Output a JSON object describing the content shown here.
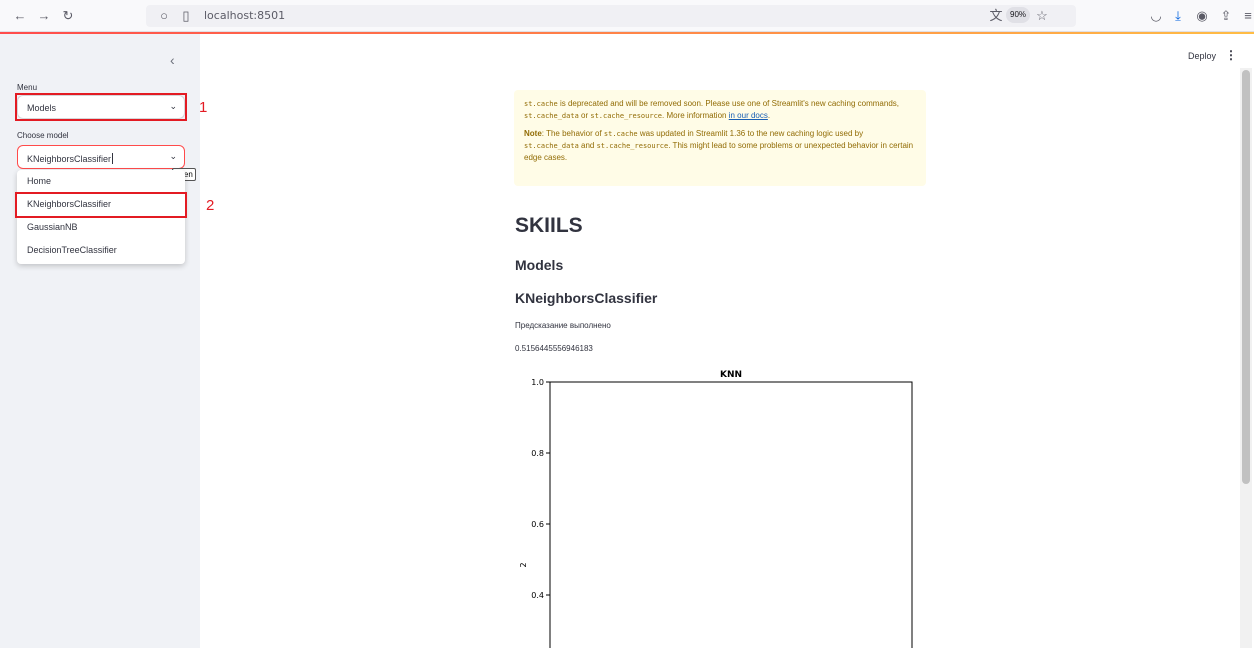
{
  "browser": {
    "url": "localhost:8501",
    "zoom": "90%"
  },
  "sidebar": {
    "menu_label": "Menu",
    "menu_value": "Models",
    "choose_label": "Choose model",
    "choose_value": "KNeighborsClassifier",
    "tooltip": "open",
    "options": [
      "Home",
      "KNeighborsClassifier",
      "GaussianNB",
      "DecisionTreeClassifier"
    ],
    "annotation_1": "1",
    "annotation_2": "2"
  },
  "header": {
    "deploy_label": "Deploy",
    "menu_icon": "⋮"
  },
  "warning": {
    "p1_pre": "st.cache",
    "p1_a": " is deprecated and will be removed soon. Please use one of Streamlit's new caching commands, ",
    "p1_code2": "st.cache_data",
    "p1_or": " or ",
    "p1_code3": "st.cache_resource",
    "p1_b": ". More information ",
    "p1_link": "in our docs",
    "p1_end": ".",
    "p2_note": "Note",
    "p2_a": ": The behavior of ",
    "p2_code1": "st.cache",
    "p2_b": " was updated in Streamlit 1.36 to the new caching logic used by ",
    "p2_code2": "st.cache_data",
    "p2_and": " and ",
    "p2_code3": "st.cache_resource",
    "p2_c": ". This might lead to some problems or unexpected behavior in certain edge cases."
  },
  "main": {
    "title": "SKIILS",
    "subtitle": "Models",
    "model_heading": "KNeighborsClassifier",
    "status_text": "Предсказание выполнено",
    "score": "0.5156445556946183"
  },
  "chart_data": {
    "type": "line",
    "title": "KNN",
    "ylabel": "2",
    "xlabel": "",
    "ylim": [
      0.3,
      1.0
    ],
    "yticks": [
      "1.0",
      "0.8",
      "0.6",
      "0.4"
    ],
    "series": []
  }
}
